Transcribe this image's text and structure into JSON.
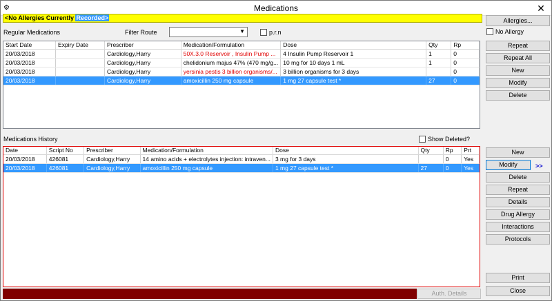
{
  "window": {
    "title": "Medications",
    "app_icon": "⚙",
    "close": "✕"
  },
  "allergy": {
    "text": "<No Allergies Currently ",
    "highlight": "Recorded>"
  },
  "regular": {
    "label": "Regular Medications",
    "filter_label": "Filter Route",
    "filter_value": "",
    "prn_label": "p.r.n",
    "columns": [
      "Start Date",
      "Expiry Date",
      "Prescriber",
      "Medication/Formulation",
      "Dose",
      "Qty",
      "Rp"
    ],
    "rows": [
      {
        "c": [
          "20/03/2018",
          "",
          "Cardiology,Harry",
          "50X.3.0 Reservoir , Insulin Pump ...",
          "4 Insulin Pump Reservoir 1",
          "1",
          "0"
        ],
        "red_med": true,
        "selected": false
      },
      {
        "c": [
          "20/03/2018",
          "",
          "Cardiology,Harry",
          "chelidonium majus 47% (470 mg/g...",
          "10 mg for 10 days 1 mL",
          "1",
          "0"
        ],
        "red_med": false,
        "selected": false
      },
      {
        "c": [
          "20/03/2018",
          "",
          "Cardiology,Harry",
          "yersinia pestis 3 billion organisms/...",
          "3 billion organisms for 3 days",
          "",
          "0"
        ],
        "red_med": true,
        "selected": false
      },
      {
        "c": [
          "20/03/2018",
          "",
          "Cardiology,Harry",
          "amoxicillin 250 mg capsule",
          "1 mg 27 capsule test *",
          "27",
          "0"
        ],
        "red_med": false,
        "selected": true
      }
    ]
  },
  "history": {
    "label": "Medications History",
    "show_deleted_label": "Show Deleted?",
    "columns": [
      "Date",
      "Script No",
      "Prescriber",
      "Medication/Formulation",
      "Dose",
      "Qty",
      "Rp",
      "Prt"
    ],
    "rows": [
      {
        "c": [
          "20/03/2018",
          "426081",
          "Cardiology,Harry",
          "14 amino acids + electrolytes injection: intraven...",
          "3 mg for 3 days",
          "",
          "0",
          "Yes"
        ],
        "selected": false
      },
      {
        "c": [
          "20/03/2018",
          "426081",
          "Cardiology,Harry",
          "amoxicillin 250 mg capsule",
          "1 mg 27 capsule test *",
          "27",
          "0",
          "Yes"
        ],
        "selected": true
      }
    ]
  },
  "buttons": {
    "allergies": "Allergies...",
    "no_allergy": "No Allergy",
    "repeat": "Repeat",
    "repeat_all": "Repeat All",
    "new": "New",
    "modify": "Modify",
    "delete": "Delete",
    "h_new": "New",
    "h_modify": "Modify",
    "h_more": ">>",
    "h_delete": "Delete",
    "h_repeat": "Repeat",
    "details": "Details",
    "drug_allergy": "Drug Allergy",
    "interactions": "Interactions",
    "protocols": "Protocols",
    "print": "Print",
    "close": "Close",
    "auth_details": "Auth. Details"
  },
  "colors": {
    "allergy_bar": "#ffff00",
    "selection": "#3399ff",
    "red_text": "#e00000",
    "bottom_bar": "#800000"
  }
}
